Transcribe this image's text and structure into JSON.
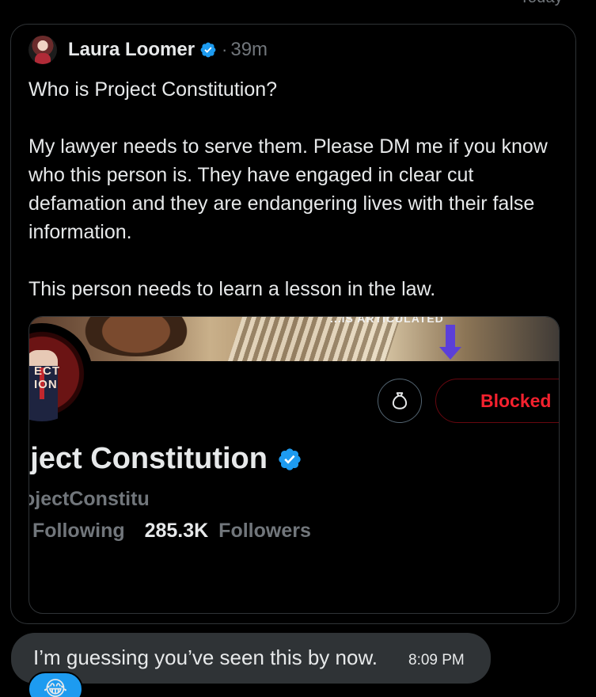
{
  "header": {
    "date_label": "Today"
  },
  "tweet": {
    "author": "Laura Loomer",
    "separator": "·",
    "time_ago": "39m",
    "paragraphs": [
      "Who is Project Constitution?",
      "My lawyer needs to serve them. Please DM me if you know who this person is. They have engaged in clear cut defamation and they are endangering lives with their false information.",
      "This person needs to learn a lesson in the law."
    ]
  },
  "embedded_profile": {
    "banner_caption": "...IS ARTICULATED",
    "avatar_text": "ECT\nION",
    "display_name": "oject Constitution",
    "handle": "ojectConstitu",
    "following_label": "Following",
    "followers_value": "285.3K",
    "followers_label": "Followers",
    "blocked_label": "Blocked"
  },
  "message": {
    "text": "I’m guessing you’ve seen this by now.",
    "time": "8:09 PM",
    "reaction": "😂"
  },
  "colors": {
    "accent": "#1d9bf0",
    "blocked": "#f4212e",
    "muted": "#71767b",
    "bubble": "#2f3336"
  },
  "icons": [
    "verified-badge-icon",
    "money-bag-icon"
  ]
}
